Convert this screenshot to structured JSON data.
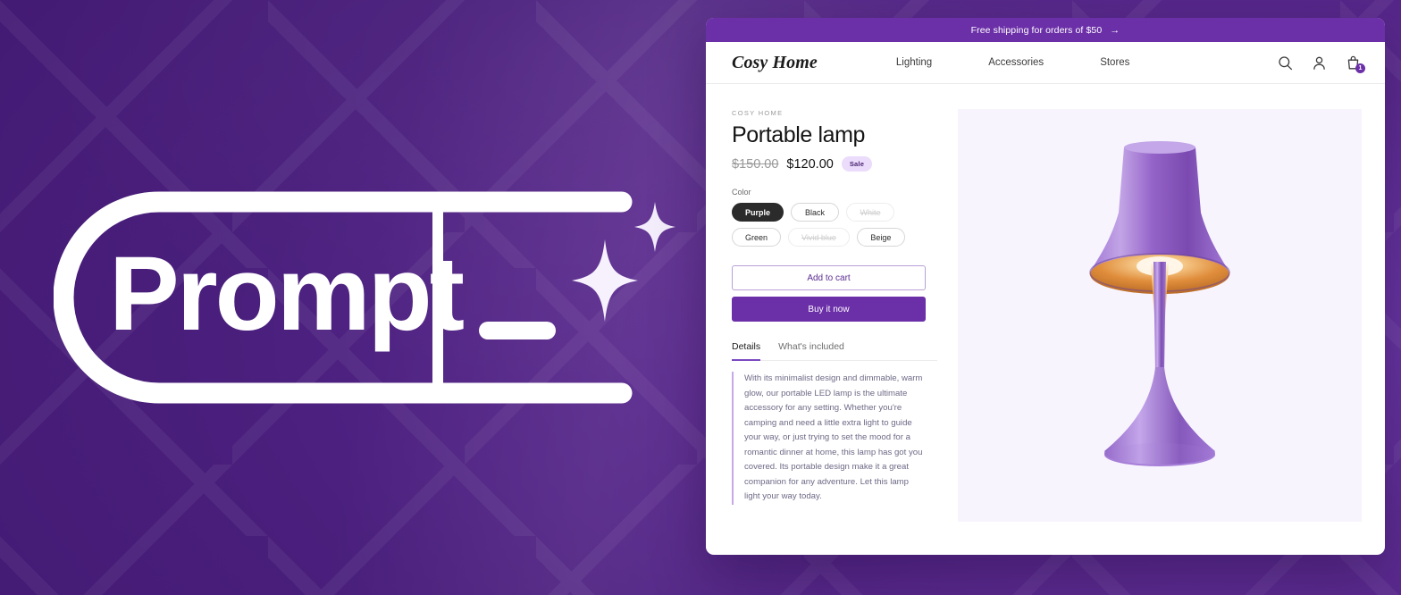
{
  "brandmark": {
    "wordmark": "Prompt",
    "sparkle_count": 2
  },
  "colors": {
    "page_bg_dark": "#3e176d",
    "page_bg_light": "#6b38a8",
    "accent_purple": "#6b2fa8",
    "sale_badge_bg": "#eadcfa",
    "media_bg": "#f8f4fe",
    "selected_pill": "#2b2b2b",
    "lamp_purple": "#9b6cd0",
    "lamp_glow": "#e8913f"
  },
  "storefront": {
    "announcement": {
      "text": "Free shipping for orders of $50",
      "arrow": "→"
    },
    "nav": {
      "brand": "Cosy Home",
      "links": [
        {
          "label": "Lighting"
        },
        {
          "label": "Accessories"
        },
        {
          "label": "Stores"
        }
      ],
      "icons": [
        {
          "name": "search-icon"
        },
        {
          "name": "account-icon"
        },
        {
          "name": "cart-icon",
          "badge": "1"
        }
      ]
    },
    "product": {
      "eyebrow": "COSY HOME",
      "title": "Portable lamp",
      "price_compare": "$150.00",
      "price_current": "$120.00",
      "sale_label": "Sale",
      "color_label": "Color",
      "colors": [
        {
          "label": "Purple",
          "state": "selected"
        },
        {
          "label": "Black",
          "state": "available"
        },
        {
          "label": "White",
          "state": "disabled"
        },
        {
          "label": "Green",
          "state": "available"
        },
        {
          "label": "Vivid blue",
          "state": "disabled"
        },
        {
          "label": "Beige",
          "state": "available"
        }
      ],
      "add_to_cart_label": "Add to cart",
      "buy_now_label": "Buy it now",
      "tabs": [
        {
          "label": "Details",
          "active": true
        },
        {
          "label": "What's included",
          "active": false
        }
      ],
      "description": "With its minimalist design and dimmable, warm glow, our portable LED lamp is the ultimate accessory for any setting. Whether you're camping and need a little extra light to guide your way, or just trying to set the mood for a romantic dinner at home, this lamp has got you covered. Its portable design make it a great companion for any adventure. Let this lamp light your way today.",
      "image_alt": "Purple portable table lamp with warm glowing shade"
    }
  }
}
